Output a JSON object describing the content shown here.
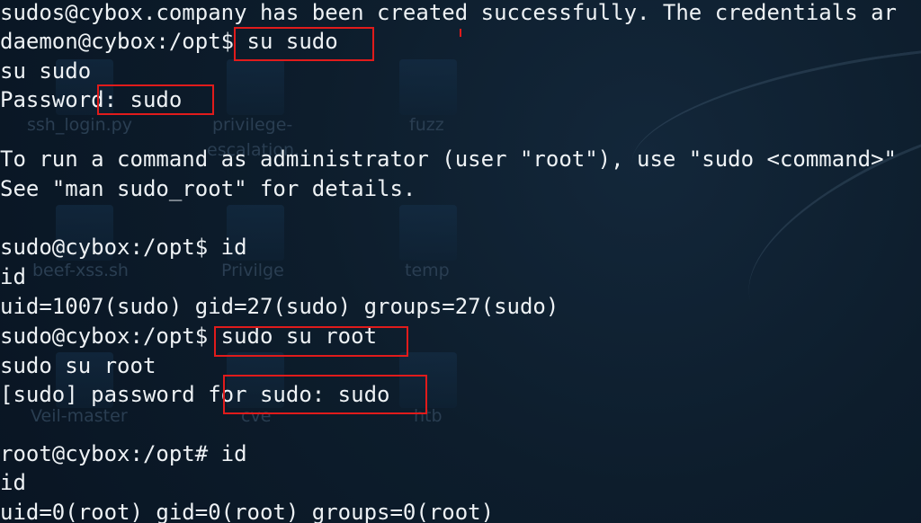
{
  "background": {
    "desktop_icons": [
      {
        "label": "ssh_login.py"
      },
      {
        "label": "privilege-"
      },
      {
        "label": "escalation..."
      },
      {
        "label": "fuzz"
      },
      {
        "label": "beef-xss.sh"
      },
      {
        "label": "Privilge"
      },
      {
        "label": "temp"
      },
      {
        "label": "Veil-master"
      },
      {
        "label": "cve"
      },
      {
        "label": "htb"
      }
    ]
  },
  "terminal": {
    "lines": [
      "sudos@cybox.company has been created successfully. The credentials ar",
      "daemon@cybox:/opt$ su sudo",
      "su sudo",
      "Password: sudo",
      "",
      "To run a command as administrator (user \"root\"), use \"sudo <command>\"",
      "See \"man sudo_root\" for details.",
      "",
      "sudo@cybox:/opt$ id",
      "id",
      "uid=1007(sudo) gid=27(sudo) groups=27(sudo)",
      "sudo@cybox:/opt$ sudo su root",
      "sudo su root",
      "[sudo] password for sudo: sudo",
      "",
      "root@cybox:/opt# id",
      "id",
      "uid=0(root) gid=0(root) groups=0(root)"
    ]
  },
  "colors": {
    "background": "#0b1a29",
    "text": "#eef2f5",
    "highlight": "#e11b1b"
  }
}
